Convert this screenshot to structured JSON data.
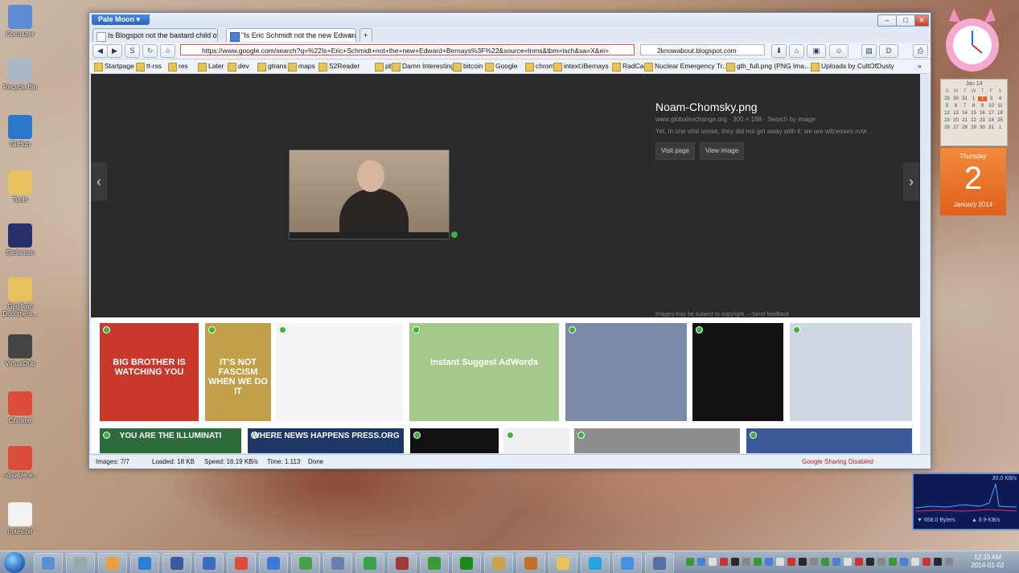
{
  "desktop_icons": [
    {
      "label": "Computer",
      "color": "#5d8bd6"
    },
    {
      "label": "Recycle Bin",
      "color": "#aab7c4"
    },
    {
      "label": "GitHub",
      "color": "#2b77c9"
    },
    {
      "label": "Tools",
      "color": "#e5c25e"
    },
    {
      "label": "Stellarium",
      "color": "#27306b"
    },
    {
      "label": "Gpg4win Document...",
      "color": "#e5c25e"
    },
    {
      "label": "VirtualDub",
      "color": "#444"
    },
    {
      "label": "Chrome",
      "color": "#dd4b39"
    },
    {
      "label": "--disable-e...",
      "color": "#dd4b39"
    },
    {
      "label": "notes.txt",
      "color": "#f2f2f2"
    }
  ],
  "browser": {
    "app_button": "Pale Moon",
    "tabs": [
      {
        "title": "Is Blogspot not the bastard child of C..."
      },
      {
        "title": "\"Is Eric Schmidt not the new Edward ..."
      }
    ],
    "new_tab": "+",
    "url": "https://www.google.com/search?q=%22Is+Eric+Schmidt+not+the+new+Edward+Bernays%3F%22&source=lnms&tbm=isch&sa=X&ei=",
    "search_value": "2knowabout.blogspot.com",
    "bookmarks": [
      "Startpage",
      "tt-rss",
      "res",
      "Later",
      "dev",
      "gtrans",
      "maps",
      "S2Reader",
      "pb",
      "Damn Interesting",
      "bitcoin",
      "Google",
      "chrome",
      "intext:iBernays",
      "RadCast",
      "Nuclear Emergency Tr...",
      "gth_full.png (PNG Ima...",
      "Uploads by CultOfDusty"
    ],
    "bookmarks_overflow": "»",
    "image_panel": {
      "title": "Noam-Chomsky.png",
      "meta": "www.globalexchange.org · 300 × 168 · Search by image",
      "description": "Yet, in one vital sense, they did not get away with it; we are witnesses now ...",
      "visit_page": "Visit page",
      "view_image": "View image",
      "note": "Images may be subject to copyright. – Send feedback",
      "prev": "‹",
      "next": "›"
    },
    "thumbs_row1": [
      {
        "text": "BIG BROTHER IS WATCHING YOU",
        "bg": "#c8392b"
      },
      {
        "text": "IT'S NOT FASCISM WHEN WE DO IT",
        "bg": "#c2a04a"
      },
      {
        "text": "",
        "bg": "#f4f4f4"
      },
      {
        "text": "Instant Suggest   AdWords",
        "bg": "#a5c98c"
      },
      {
        "text": "",
        "bg": "#7a8aa8"
      },
      {
        "text": "",
        "bg": "#111111"
      },
      {
        "text": "",
        "bg": "#cfd8e2"
      }
    ],
    "thumbs_row2": [
      {
        "text": "YOU ARE THE ILLUMINATI",
        "bg": "#2d6b3a"
      },
      {
        "text": "WHERE NEWS HAPPENS PRESS.ORG",
        "bg": "#1d3866"
      },
      {
        "text": "",
        "bg": "#111111"
      },
      {
        "text": "",
        "bg": "#eeeeee"
      },
      {
        "text": "",
        "bg": "#8d8d8d"
      },
      {
        "text": "",
        "bg": "#3c5a9a"
      }
    ],
    "status": {
      "images": "Images: 7/7",
      "loaded": "Loaded: 18 KB",
      "speed": "Speed: 16.19 KB/s",
      "time": "Time: 1.113",
      "state": "Done",
      "sharing": "Google Sharing Disabled"
    }
  },
  "calendar": {
    "month": "Jan 14",
    "weekdays": [
      "S",
      "M",
      "T",
      "W",
      "T",
      "F",
      "S"
    ],
    "weeks": [
      [
        "29",
        "30",
        "31",
        "1",
        "2",
        "3",
        "4"
      ],
      [
        "5",
        "6",
        "7",
        "8",
        "9",
        "10",
        "11"
      ],
      [
        "12",
        "13",
        "14",
        "15",
        "16",
        "17",
        "18"
      ],
      [
        "19",
        "20",
        "21",
        "22",
        "23",
        "24",
        "25"
      ],
      [
        "26",
        "27",
        "28",
        "29",
        "30",
        "31",
        "1"
      ]
    ],
    "day_name": "Thursday",
    "day_number": "2",
    "month_year": "January 2014"
  },
  "netmon": {
    "peak": "30.0 KB/s",
    "down": "658.0 Byte/s",
    "up": "8.9 KB/s"
  },
  "taskbar": {
    "time": "12:33 AM",
    "date": "2014-01-02",
    "icon_colors": [
      "#5a8fd1",
      "#9aa",
      "#e8a23c",
      "#2a7fd0",
      "#3a5a9a",
      "#3b6cc1",
      "#dd4b39",
      "#3a7bd5",
      "#4aa04a",
      "#6a7fb0",
      "#3aa04a",
      "#a03a3a",
      "#3a9a3a",
      "#1a8a1a",
      "#caa24a",
      "#c3702a",
      "#e8c35a",
      "#27a3e0",
      "#4a90e2",
      "#5a6fa0"
    ]
  }
}
